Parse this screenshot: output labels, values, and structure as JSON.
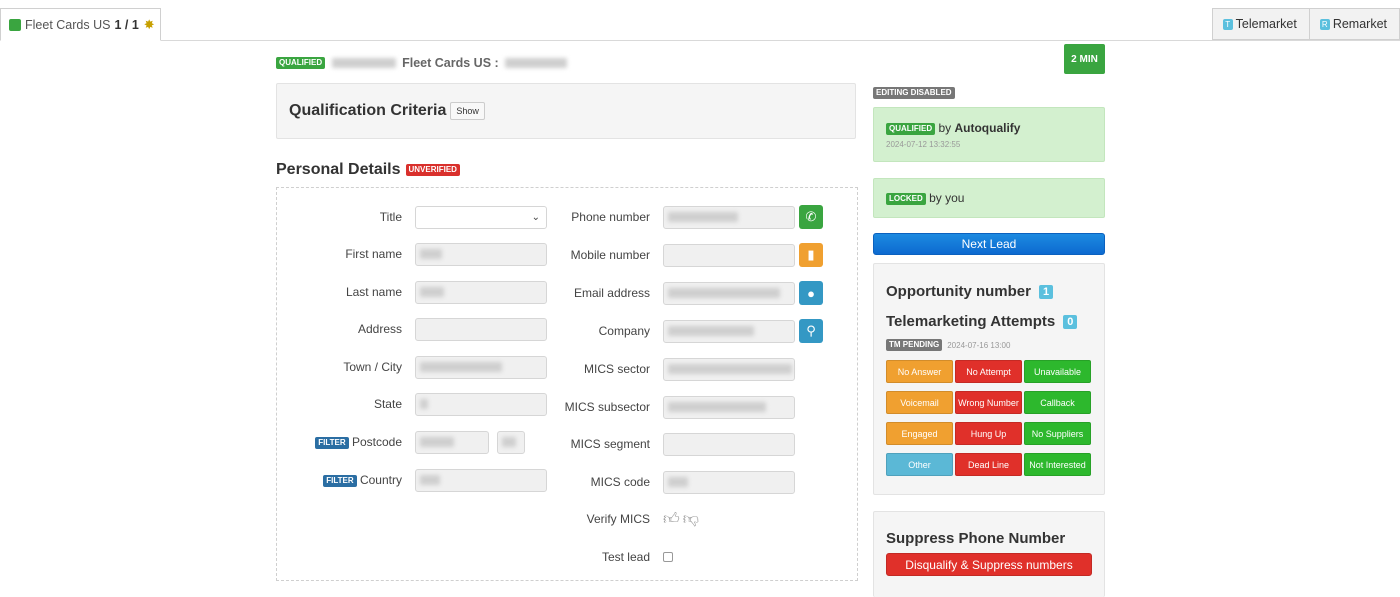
{
  "tabs": {
    "active_label": "Fleet Cards US",
    "active_count": "1 / 1",
    "right_buttons": [
      "Telemarket",
      "Remarket"
    ]
  },
  "header": {
    "status_badge": "QUALIFIED",
    "campaign": "Fleet Cards US :",
    "timer": "2 MIN"
  },
  "qualification": {
    "title": "Qualification Criteria",
    "show_button": "Show"
  },
  "personal_details": {
    "title": "Personal Details",
    "status_badge": "UNVERIFIED",
    "left_fields": [
      {
        "label": "Title"
      },
      {
        "label": "First name"
      },
      {
        "label": "Last name"
      },
      {
        "label": "Address"
      },
      {
        "label": "Town / City"
      },
      {
        "label": "State"
      },
      {
        "label": "Postcode",
        "tag": "FILTER"
      },
      {
        "label": "Country",
        "tag": "FILTER"
      }
    ],
    "right_fields": [
      {
        "label": "Phone number",
        "action": "phone-icon"
      },
      {
        "label": "Mobile number",
        "action": "mobile-icon"
      },
      {
        "label": "Email address",
        "action": "globe-icon"
      },
      {
        "label": "Company",
        "action": "search-icon"
      },
      {
        "label": "MICS sector"
      },
      {
        "label": "MICS subsector"
      },
      {
        "label": "MICS segment"
      },
      {
        "label": "MICS code"
      },
      {
        "label": "Verify MICS"
      },
      {
        "label": "Test lead"
      }
    ]
  },
  "sidebar": {
    "editing_badge": "EDITING DISABLED",
    "qualified": {
      "badge": "QUALIFIED",
      "by_text": "by",
      "by_name": "Autoqualify",
      "timestamp": "2024-07-12 13:32:55"
    },
    "locked": {
      "badge": "LOCKED",
      "by_text": "by you"
    },
    "next_lead": "Next Lead",
    "opportunity": {
      "label": "Opportunity number",
      "count": "1"
    },
    "telemarketing": {
      "label": "Telemarketing Attempts",
      "count": "0",
      "pending_badge": "TM PENDING",
      "pending_time": "2024-07-16 13:00",
      "outcomes": [
        {
          "label": "No Answer",
          "color": "#f0a030"
        },
        {
          "label": "No Attempt",
          "color": "#e0302a"
        },
        {
          "label": "Unavailable",
          "color": "#2db82d"
        },
        {
          "label": "Voicemail",
          "color": "#f0a030"
        },
        {
          "label": "Wrong Number",
          "color": "#e0302a"
        },
        {
          "label": "Callback",
          "color": "#2db82d"
        },
        {
          "label": "Engaged",
          "color": "#f0a030"
        },
        {
          "label": "Hung Up",
          "color": "#e0302a"
        },
        {
          "label": "No Suppliers",
          "color": "#2db82d"
        },
        {
          "label": "Other",
          "color": "#5bb8d6"
        },
        {
          "label": "Dead Line",
          "color": "#e0302a"
        },
        {
          "label": "Not Interested",
          "color": "#2db82d"
        }
      ]
    },
    "suppress": {
      "title": "Suppress Phone Number",
      "button": "Disqualify & Suppress numbers"
    }
  }
}
